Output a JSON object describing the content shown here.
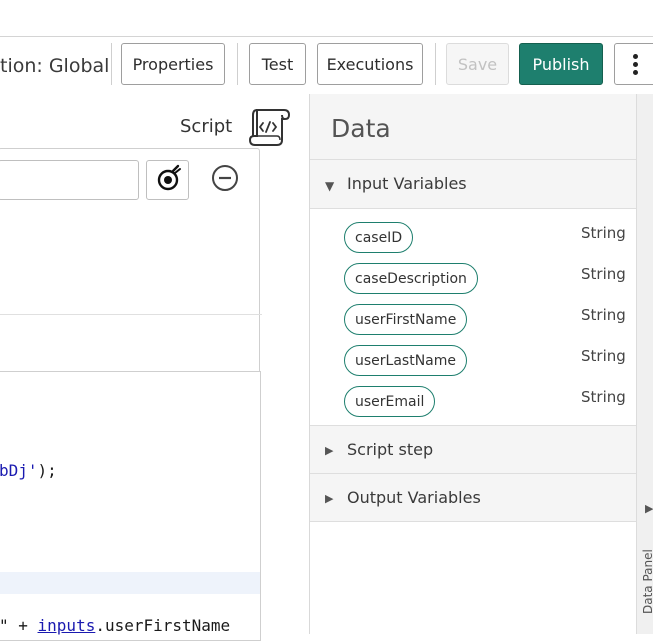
{
  "toolbar": {
    "scope_label": "tion: Global",
    "properties_label": "Properties",
    "test_label": "Test",
    "executions_label": "Executions",
    "save_label": "Save",
    "publish_label": "Publish"
  },
  "script_step": {
    "label": "Script",
    "icon": "script-scroll-icon",
    "code_fragment_1_str": "bDj'",
    "code_fragment_1_rest": ");",
    "code_fragment_2_str": "\" + ",
    "code_fragment_2_link": "inputs",
    "code_fragment_2_rest": ".userFirstName"
  },
  "data_panel": {
    "title": "Data",
    "input_section_label": "Input Variables",
    "variables": [
      {
        "name": "caseID",
        "type": "String"
      },
      {
        "name": "caseDescription",
        "type": "String"
      },
      {
        "name": "userFirstName",
        "type": "String"
      },
      {
        "name": "userLastName",
        "type": "String"
      },
      {
        "name": "userEmail",
        "type": "String"
      }
    ],
    "script_step_section_label": "Script step",
    "output_section_label": "Output Variables",
    "rail_label": "Data Panel"
  },
  "colors": {
    "accent": "#1e7f6e"
  }
}
